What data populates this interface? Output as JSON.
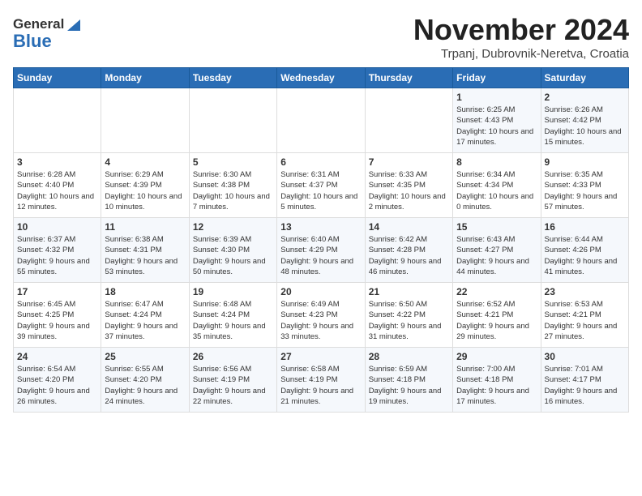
{
  "logo": {
    "general": "General",
    "blue": "Blue"
  },
  "header": {
    "month": "November 2024",
    "location": "Trpanj, Dubrovnik-Neretva, Croatia"
  },
  "weekdays": [
    "Sunday",
    "Monday",
    "Tuesday",
    "Wednesday",
    "Thursday",
    "Friday",
    "Saturday"
  ],
  "weeks": [
    [
      {
        "day": "",
        "info": ""
      },
      {
        "day": "",
        "info": ""
      },
      {
        "day": "",
        "info": ""
      },
      {
        "day": "",
        "info": ""
      },
      {
        "day": "",
        "info": ""
      },
      {
        "day": "1",
        "info": "Sunrise: 6:25 AM\nSunset: 4:43 PM\nDaylight: 10 hours and 17 minutes."
      },
      {
        "day": "2",
        "info": "Sunrise: 6:26 AM\nSunset: 4:42 PM\nDaylight: 10 hours and 15 minutes."
      }
    ],
    [
      {
        "day": "3",
        "info": "Sunrise: 6:28 AM\nSunset: 4:40 PM\nDaylight: 10 hours and 12 minutes."
      },
      {
        "day": "4",
        "info": "Sunrise: 6:29 AM\nSunset: 4:39 PM\nDaylight: 10 hours and 10 minutes."
      },
      {
        "day": "5",
        "info": "Sunrise: 6:30 AM\nSunset: 4:38 PM\nDaylight: 10 hours and 7 minutes."
      },
      {
        "day": "6",
        "info": "Sunrise: 6:31 AM\nSunset: 4:37 PM\nDaylight: 10 hours and 5 minutes."
      },
      {
        "day": "7",
        "info": "Sunrise: 6:33 AM\nSunset: 4:35 PM\nDaylight: 10 hours and 2 minutes."
      },
      {
        "day": "8",
        "info": "Sunrise: 6:34 AM\nSunset: 4:34 PM\nDaylight: 10 hours and 0 minutes."
      },
      {
        "day": "9",
        "info": "Sunrise: 6:35 AM\nSunset: 4:33 PM\nDaylight: 9 hours and 57 minutes."
      }
    ],
    [
      {
        "day": "10",
        "info": "Sunrise: 6:37 AM\nSunset: 4:32 PM\nDaylight: 9 hours and 55 minutes."
      },
      {
        "day": "11",
        "info": "Sunrise: 6:38 AM\nSunset: 4:31 PM\nDaylight: 9 hours and 53 minutes."
      },
      {
        "day": "12",
        "info": "Sunrise: 6:39 AM\nSunset: 4:30 PM\nDaylight: 9 hours and 50 minutes."
      },
      {
        "day": "13",
        "info": "Sunrise: 6:40 AM\nSunset: 4:29 PM\nDaylight: 9 hours and 48 minutes."
      },
      {
        "day": "14",
        "info": "Sunrise: 6:42 AM\nSunset: 4:28 PM\nDaylight: 9 hours and 46 minutes."
      },
      {
        "day": "15",
        "info": "Sunrise: 6:43 AM\nSunset: 4:27 PM\nDaylight: 9 hours and 44 minutes."
      },
      {
        "day": "16",
        "info": "Sunrise: 6:44 AM\nSunset: 4:26 PM\nDaylight: 9 hours and 41 minutes."
      }
    ],
    [
      {
        "day": "17",
        "info": "Sunrise: 6:45 AM\nSunset: 4:25 PM\nDaylight: 9 hours and 39 minutes."
      },
      {
        "day": "18",
        "info": "Sunrise: 6:47 AM\nSunset: 4:24 PM\nDaylight: 9 hours and 37 minutes."
      },
      {
        "day": "19",
        "info": "Sunrise: 6:48 AM\nSunset: 4:24 PM\nDaylight: 9 hours and 35 minutes."
      },
      {
        "day": "20",
        "info": "Sunrise: 6:49 AM\nSunset: 4:23 PM\nDaylight: 9 hours and 33 minutes."
      },
      {
        "day": "21",
        "info": "Sunrise: 6:50 AM\nSunset: 4:22 PM\nDaylight: 9 hours and 31 minutes."
      },
      {
        "day": "22",
        "info": "Sunrise: 6:52 AM\nSunset: 4:21 PM\nDaylight: 9 hours and 29 minutes."
      },
      {
        "day": "23",
        "info": "Sunrise: 6:53 AM\nSunset: 4:21 PM\nDaylight: 9 hours and 27 minutes."
      }
    ],
    [
      {
        "day": "24",
        "info": "Sunrise: 6:54 AM\nSunset: 4:20 PM\nDaylight: 9 hours and 26 minutes."
      },
      {
        "day": "25",
        "info": "Sunrise: 6:55 AM\nSunset: 4:20 PM\nDaylight: 9 hours and 24 minutes."
      },
      {
        "day": "26",
        "info": "Sunrise: 6:56 AM\nSunset: 4:19 PM\nDaylight: 9 hours and 22 minutes."
      },
      {
        "day": "27",
        "info": "Sunrise: 6:58 AM\nSunset: 4:19 PM\nDaylight: 9 hours and 21 minutes."
      },
      {
        "day": "28",
        "info": "Sunrise: 6:59 AM\nSunset: 4:18 PM\nDaylight: 9 hours and 19 minutes."
      },
      {
        "day": "29",
        "info": "Sunrise: 7:00 AM\nSunset: 4:18 PM\nDaylight: 9 hours and 17 minutes."
      },
      {
        "day": "30",
        "info": "Sunrise: 7:01 AM\nSunset: 4:17 PM\nDaylight: 9 hours and 16 minutes."
      }
    ]
  ]
}
